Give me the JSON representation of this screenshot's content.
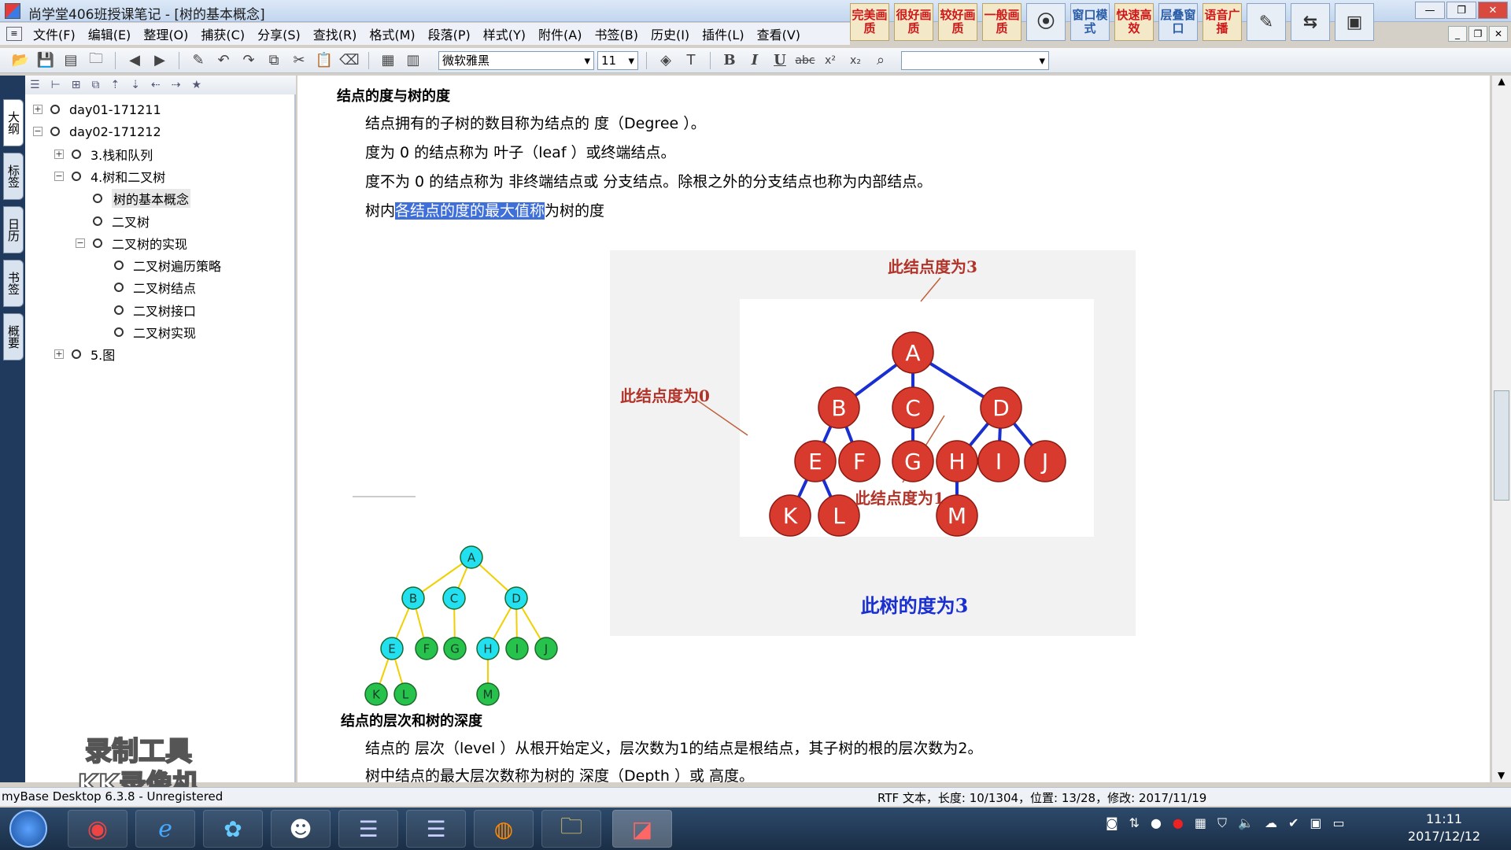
{
  "window": {
    "title": "尚学堂406班授课笔记 - [树的基本概念]",
    "quick_buttons": [
      "完美画质",
      "很好画质",
      "较好画质",
      "一般画质",
      "",
      "窗口模式",
      "快速高效",
      "层叠窗口",
      "语音广播",
      "",
      "",
      ""
    ]
  },
  "menu": [
    "文件(F)",
    "编辑(E)",
    "整理(O)",
    "捕获(C)",
    "分享(S)",
    "查找(R)",
    "格式(M)",
    "段落(P)",
    "样式(Y)",
    "附件(A)",
    "书签(B)",
    "历史(I)",
    "插件(L)",
    "查看(V)"
  ],
  "toolbar": {
    "font": "微软雅黑",
    "size": "11"
  },
  "side_tabs": [
    "大纲",
    "标签",
    "日历",
    "书签",
    "概要"
  ],
  "tree": [
    {
      "label": "day01-171211",
      "depth": 0,
      "exp": "+"
    },
    {
      "label": "day02-171212",
      "depth": 0,
      "exp": "-"
    },
    {
      "label": "3.栈和队列",
      "depth": 1,
      "exp": "+"
    },
    {
      "label": "4.树和二叉树",
      "depth": 1,
      "exp": "-"
    },
    {
      "label": "树的基本概念",
      "depth": 2,
      "exp": "",
      "selected": true
    },
    {
      "label": "二叉树",
      "depth": 2,
      "exp": ""
    },
    {
      "label": "二叉树的实现",
      "depth": 2,
      "exp": "-"
    },
    {
      "label": "二叉树遍历策略",
      "depth": 3,
      "exp": ""
    },
    {
      "label": "二叉树结点",
      "depth": 3,
      "exp": ""
    },
    {
      "label": "二叉树接口",
      "depth": 3,
      "exp": ""
    },
    {
      "label": "二叉树实现",
      "depth": 3,
      "exp": ""
    },
    {
      "label": "5.图",
      "depth": 1,
      "exp": "+"
    }
  ],
  "watermark": [
    "录制工具",
    "KK录像机"
  ],
  "doc": {
    "heading1": "结点的度与树的度",
    "p1": "结点拥有的子树的数目称为结点的 度（Degree ）。",
    "p2": "度为 0 的结点称为 叶子（leaf ）或终端结点。",
    "p3": "度不为 0 的结点称为 非终端结点或 分支结点。除根之外的分支结点也称为内部结点。",
    "p4_pre": "树内",
    "p4_hl": "各结点的度的最大值称",
    "p4_post": "为树的度",
    "heading2": "结点的层次和树的深度",
    "p5": "结点的 层次（level ）从根开始定义，层次数为1的结点是根结点，其子树的根的层次数为2。",
    "p6": "树中结点的最大层次数称为树的 深度（Depth ）或 高度。"
  },
  "small_tree": {
    "nodes": [
      "A",
      "B",
      "C",
      "D",
      "E",
      "F",
      "G",
      "H",
      "I",
      "J",
      "K",
      "L",
      "M"
    ]
  },
  "big_tree": {
    "nodes": [
      "A",
      "B",
      "C",
      "D",
      "E",
      "F",
      "G",
      "H",
      "I",
      "J",
      "K",
      "L",
      "M"
    ],
    "annotation_root": "此结点度为3",
    "annotation_leaf": "此结点度为0",
    "annotation_one": "此结点度为1",
    "caption": "此树的度为3"
  },
  "status": {
    "left": "myBase Desktop 6.3.8 - Unregistered",
    "right": "RTF 文本，长度: 10/1304，位置: 13/28，修改: 2017/11/19"
  },
  "clock": {
    "time": "11:11",
    "date": "2017/12/12"
  }
}
